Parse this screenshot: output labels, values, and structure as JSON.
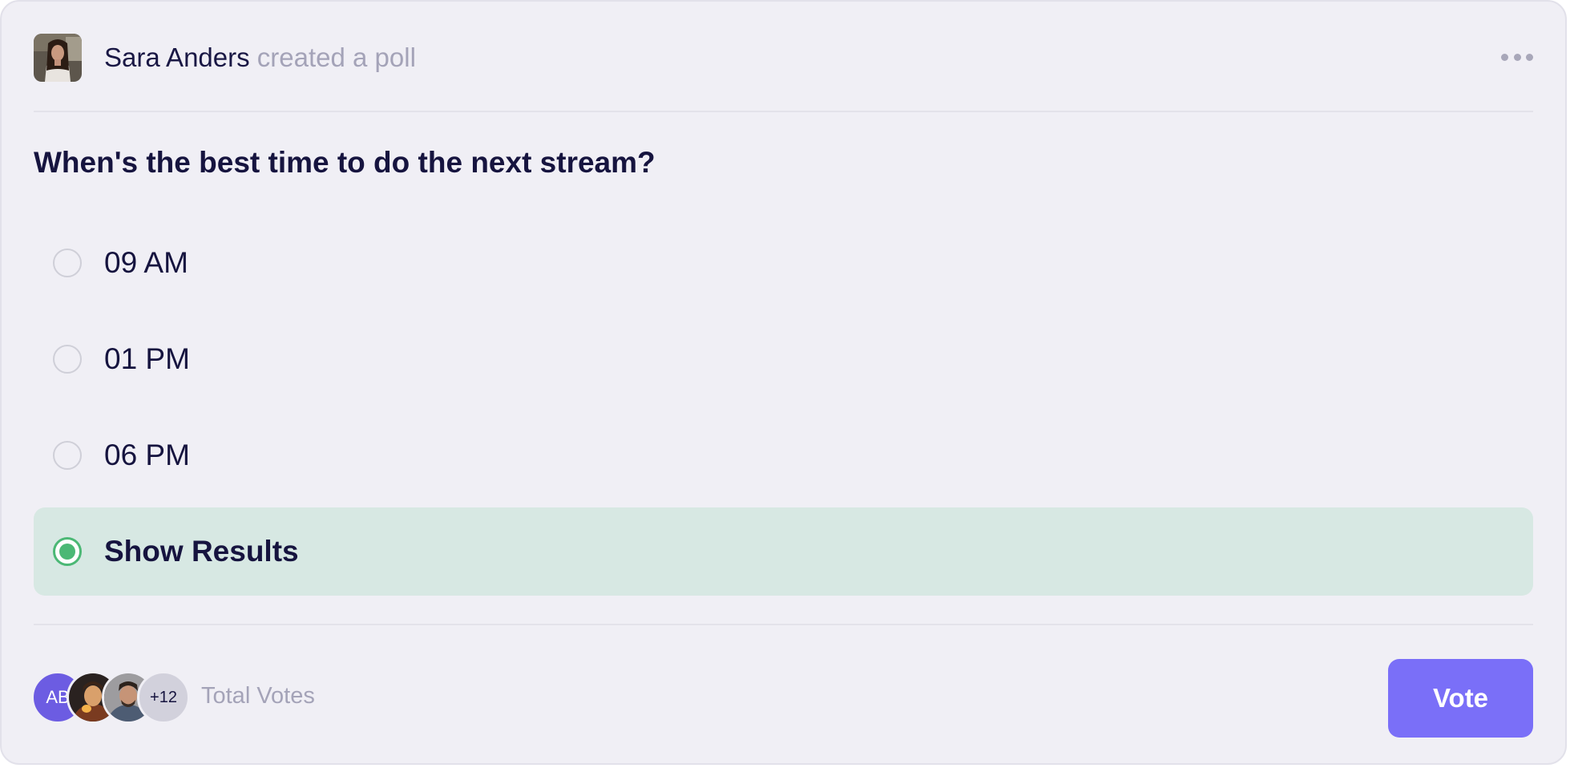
{
  "poll": {
    "author": {
      "name": "Sara Anders",
      "action": "created a poll"
    },
    "question": "When's the best time to do the next stream?",
    "options": [
      {
        "label": "09 AM",
        "selected": false
      },
      {
        "label": "01 PM",
        "selected": false
      },
      {
        "label": "06 PM",
        "selected": false
      },
      {
        "label": "Show Results",
        "selected": true
      }
    ]
  },
  "footer": {
    "voters": {
      "first_initials": "AB",
      "more_count": "+12"
    },
    "total_votes_label": "Total Votes",
    "vote_button_label": "Vote"
  },
  "icons": {
    "more": "more-horizontal-icon"
  },
  "colors": {
    "accent": "#7a6ff8",
    "selected_bg": "#d7e8e3",
    "selected_radio": "#4bb875",
    "text_primary": "#16143f",
    "text_muted": "#a4a3b8",
    "card_bg": "#f0eff5"
  }
}
